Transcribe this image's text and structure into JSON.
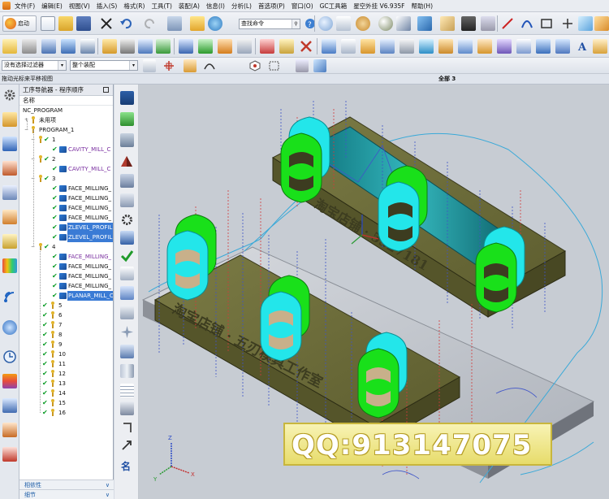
{
  "menu": {
    "items": [
      "文件(F)",
      "编辑(E)",
      "视图(V)",
      "插入(S)",
      "格式(R)",
      "工具(T)",
      "装配(A)",
      "信息(I)",
      "分析(L)",
      "首选项(P)",
      "窗口(O)",
      "GC工具箱",
      "星空外挂 V6.935F",
      "帮助(H)"
    ]
  },
  "toolbar": {
    "start_label": "启动",
    "command_search_placeholder": "查找命令",
    "selection_filter_value": "没有选择过滤器",
    "assembly_scope_value": "整个装配"
  },
  "view_title": {
    "left": "拖动光标来平移视图",
    "right": "全部 3"
  },
  "navigator": {
    "title": "工序导航器 - 程序顺序",
    "column_header": "名称",
    "root": "NC_PROGRAM",
    "unused": "未用项",
    "program": "PROGRAM_1",
    "groups": [
      {
        "label": "1",
        "ops": [
          "CAVITY_MILL_C"
        ]
      },
      {
        "label": "2",
        "ops": [
          "CAVITY_MILL_C"
        ]
      },
      {
        "label": "3",
        "ops": [
          "FACE_MILLING_",
          "FACE_MILLING_",
          "FACE_MILLING_",
          "FACE_MILLING_",
          "ZLEVEL_PROFIL",
          "ZLEVEL_PROFIL"
        ]
      },
      {
        "label": "4",
        "ops": [
          "FACE_MILLING_",
          "FACE_MILLING_",
          "FACE_MILLING_",
          "FACE_MILLING_",
          "PLANAR_MILL_C"
        ]
      }
    ],
    "empty_groups": [
      "5",
      "6",
      "7",
      "8",
      "9",
      "10",
      "11",
      "12",
      "13",
      "14",
      "15",
      "16"
    ],
    "footer": [
      "相依性",
      "细节"
    ]
  },
  "graphics": {
    "engraving_top": "淘宝店铺 · 5327181",
    "engraving_bottom": "淘宝店铺 · 五刃模具工作室",
    "axis_labels": [
      "X",
      "Y",
      "Z"
    ]
  },
  "watermark": "QQ:913147075",
  "colors": {
    "part_cyan": "#23e6ea",
    "part_green": "#19e01a",
    "base_olive": "#6b6b3a",
    "toolpath_blue": "#3f54c8",
    "toolpath_red": "#d23a3a",
    "selection_blue": "#3a7bd5"
  }
}
